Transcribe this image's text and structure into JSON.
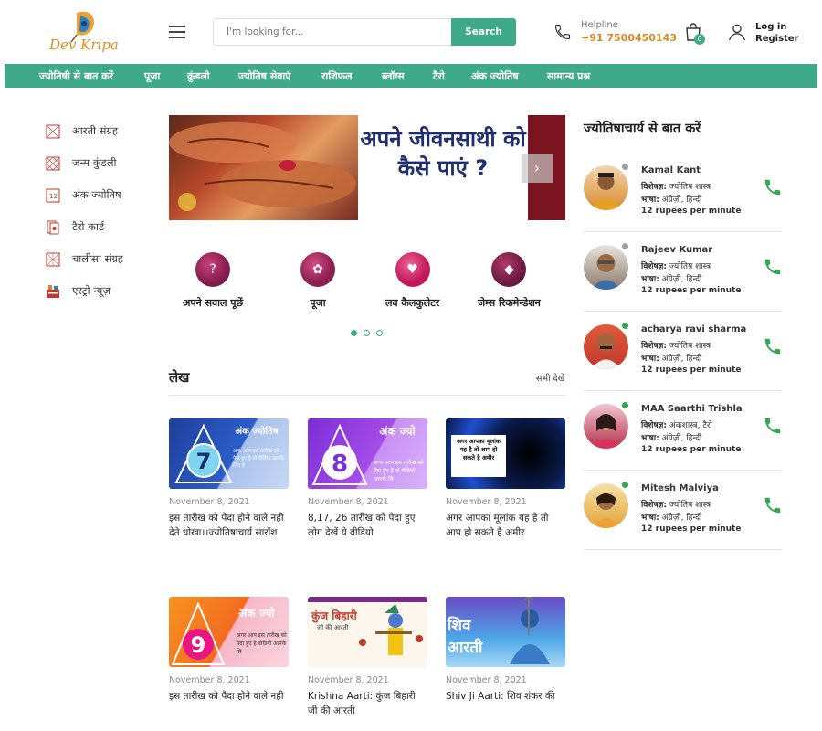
{
  "header": {
    "logo_text": "Dev Kripa",
    "search_placeholder": "I'm looking for...",
    "search_button": "Search",
    "helpline_label": "Helpline",
    "helpline_number": "+91 7500450143",
    "cart_count": "0",
    "login_label": "Log in",
    "register_label": "Register"
  },
  "nav": [
    "ज्योतिषी से बात करें",
    "पूजा",
    "कुंडली",
    "ज्योतिष सेवाएं",
    "राशिफल",
    "ब्लॉग्स",
    "टैरो",
    "अंक ज्योतिष",
    "सामान्य प्रश्न"
  ],
  "sidebar": [
    {
      "label": "आरती संग्रह",
      "icon": "aarti-icon"
    },
    {
      "label": "जन्म कुंडली",
      "icon": "kundli-icon"
    },
    {
      "label": "अंक ज्योतिष",
      "icon": "numerology-icon"
    },
    {
      "label": "टैरो कार्ड",
      "icon": "tarot-icon"
    },
    {
      "label": "चालीसा संग्रह",
      "icon": "chalisa-icon"
    },
    {
      "label": "एस्ट्रो न्यूज़",
      "icon": "news-icon"
    }
  ],
  "banner": {
    "headline": "अपने जीवनसाथी को कैसे पाएं ?"
  },
  "quick_links": [
    "अपने सवाल पूछें",
    "पूजा",
    "लव कैलकुलेटर",
    "जेम्स रिकमेन्डेशन"
  ],
  "articles": {
    "title": "लेख",
    "see_all": "सभी देखें",
    "items": [
      {
        "date": "November 8, 2021",
        "title": "इस तारीख को पैदा होने वाले नही देते धोखा।।ज्योतिषाचार्य सारॉश",
        "img_number": "7",
        "img_heading": "अंक ज्योतिष",
        "img_caption": "अगर आप इस तारीख को पैदा हुए है तो वीडियो आपके लिए है"
      },
      {
        "date": "November 8, 2021",
        "title": "8,17, 26 तारीख को पैदा हुए लोग देखें ये वीडियो",
        "img_number": "8",
        "img_heading": "अंक ज्यो",
        "img_caption": "अगर आप इस तारीख को पैदा हुए हैं तो वीडियो आपके लि"
      },
      {
        "date": "November 8, 2021",
        "title": "अगर आपका मूलांक यह है तो आप हो सकते है अमीर",
        "img_caption": "अगर आपका मूलांक यह है तो आप हो सकते है अमीर"
      },
      {
        "date": "November 8, 2021",
        "title": "इस तारीख को पैदा होने वाले नही",
        "img_number": "9",
        "img_heading": "अंक ज्यो",
        "img_caption": "अगर आप इस तारीख को पैदा हुए है वीडियो आपके लि"
      },
      {
        "date": "November 8, 2021",
        "title": "Krishna Aarti: कुंज बिहारी जी की आरती",
        "img_heading": "कुंज बिहारी",
        "img_caption": "जी की आरती"
      },
      {
        "date": "November 8, 2021",
        "title": "Shiv Ji Aarti: शिव शंकर की",
        "img_heading": "शिव आरती"
      }
    ]
  },
  "astrologers_panel": {
    "title": "ज्योतिषाचार्य से बात करें",
    "specialty_label": "विशेषज्ञ:",
    "language_label": "भाषा:",
    "items": [
      {
        "name": "Kamal Kant",
        "specialty": "ज्योतिष शास्त्र",
        "languages": "अंग्रेज़ी, हिन्दी",
        "rate": "12 rupees per minute",
        "status_color": "#9e9e9e",
        "avatar_color": "#d98a2b"
      },
      {
        "name": "Rajeev Kumar",
        "specialty": "ज्योतिष शास्त्र",
        "languages": "अंग्रेज़ी, हिन्दी",
        "rate": "12 rupees per minute",
        "status_color": "#9e9e9e",
        "avatar_color": "#6b5a4a"
      },
      {
        "name": "acharya ravi sharma",
        "specialty": "ज्योतिष शास्त्र",
        "languages": "अंग्रेज़ी, हिन्दी",
        "rate": "12 rupees per minute",
        "status_color": "#2fa84f",
        "avatar_color": "#c0392b"
      },
      {
        "name": "MAA Saarthi Trishla",
        "specialty": "अंकशास्त्र, टैरो",
        "languages": "अंग्रेज़ी, हिन्दी",
        "rate": "12 rupees per minute",
        "status_color": "#2fa84f",
        "avatar_color": "#b5304a"
      },
      {
        "name": "Mitesh Malviya",
        "specialty": "ज्योतिष शास्त्र",
        "languages": "अंग्रेज़ी, हिन्दी",
        "rate": "12 rupees per minute",
        "status_color": "#2fa84f",
        "avatar_color": "#e0a53a"
      }
    ]
  },
  "colors": {
    "accent": "#3eaa87",
    "brand_orange": "#e08a1e",
    "call_green": "#2fa84f"
  }
}
